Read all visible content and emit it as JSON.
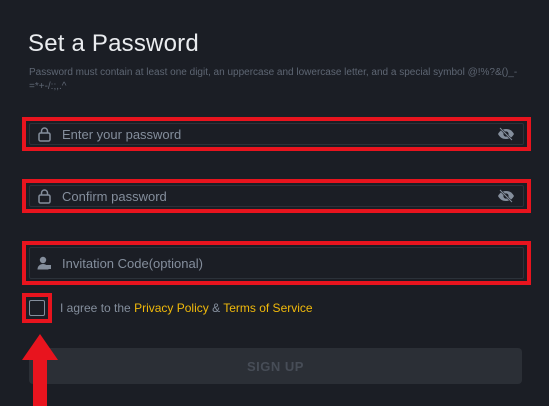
{
  "title": "Set a Password",
  "hint": "Password must contain at least one digit, an uppercase and lowercase letter, and a special symbol @!%?&()_-=*+-/:;,.^",
  "fields": {
    "password": {
      "placeholder": "Enter your password",
      "icon": "lock-icon",
      "toggle_icon": "eye-off-icon"
    },
    "confirm": {
      "placeholder": "Confirm password",
      "icon": "lock-icon",
      "toggle_icon": "eye-off-icon"
    },
    "invitation": {
      "placeholder": "Invitation Code(optional)",
      "icon": "user-icon"
    }
  },
  "agree": {
    "prefix": "I agree to the ",
    "privacy_link": "Privacy Policy",
    "amp": " & ",
    "terms_link": "Terms of Service",
    "checked": false
  },
  "signup_label": "SIGN UP",
  "colors": {
    "background": "#1b1e25",
    "highlight": "#e8141e",
    "link": "#f0b90b",
    "button": "#2b2f36"
  }
}
